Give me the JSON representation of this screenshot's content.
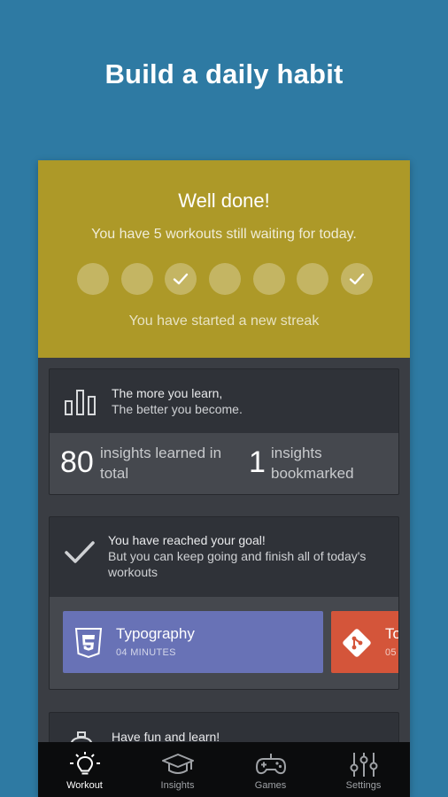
{
  "headline": "Build a daily habit",
  "banner": {
    "title": "Well done!",
    "subtitle": "You have 5 workouts still waiting for today.",
    "days": [
      false,
      false,
      true,
      false,
      false,
      false,
      true
    ],
    "streak_text": "You have started a new streak",
    "color": "#ad9928"
  },
  "learn_card": {
    "line1": "The more you learn,",
    "line2": "The better you become.",
    "icon": "bar-chart-icon",
    "stats": [
      {
        "value": "80",
        "label_line1": "insights learned in",
        "label_line2": "total"
      },
      {
        "value": "1",
        "label_line1": "insights",
        "label_line2": "bookmarked"
      }
    ]
  },
  "goal_card": {
    "line1": "You have reached your goal!",
    "line2": "But you can keep going and finish all of today's",
    "line3": "workouts",
    "icon": "checkmark-icon",
    "lessons": [
      {
        "name": "Typography",
        "duration": "04 MINUTES",
        "icon": "css3-icon",
        "color": "#6872b6"
      },
      {
        "name": "To",
        "duration": "05",
        "icon": "git-icon",
        "color": "#d4553a"
      }
    ]
  },
  "fun_card": {
    "line1": "Have fun and learn!",
    "icon": "lamp-icon"
  },
  "nav": [
    {
      "label": "Workout",
      "icon": "lightbulb-icon",
      "active": true
    },
    {
      "label": "Insights",
      "icon": "graduation-cap-icon",
      "active": false
    },
    {
      "label": "Games",
      "icon": "gamepad-icon",
      "active": false
    },
    {
      "label": "Settings",
      "icon": "sliders-icon",
      "active": false
    }
  ]
}
